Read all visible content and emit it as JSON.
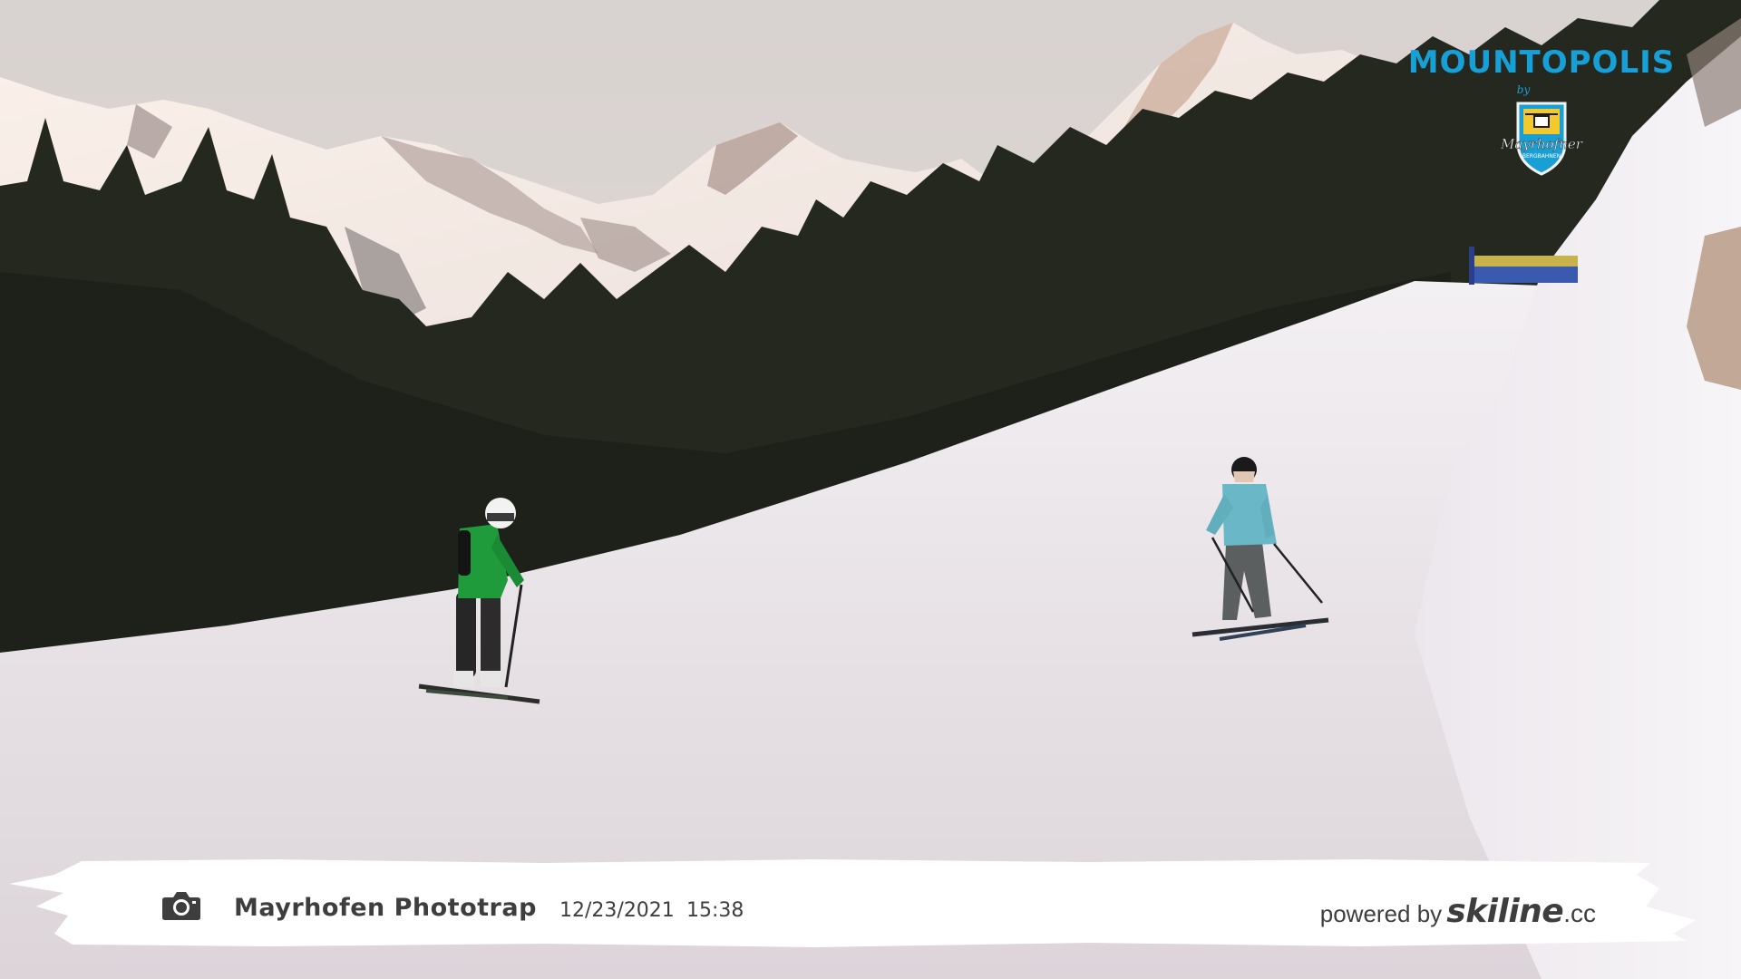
{
  "brand": {
    "name": "MOUNTOPOLIS",
    "by": "by",
    "partner": "Mayrhofner",
    "partner_sub": "BERGBAHNEN"
  },
  "caption": {
    "camera_icon": "camera-icon",
    "title": "Mayrhofen Phototrap",
    "date": "12/23/2021",
    "time": "15:38"
  },
  "powered": {
    "prefix": "powered by",
    "name": "skiline",
    "suffix": ".cc"
  },
  "colors": {
    "brand_blue": "#17a0d8",
    "caption_text": "#3e3e3e",
    "caption_bg": "#ffffff"
  }
}
